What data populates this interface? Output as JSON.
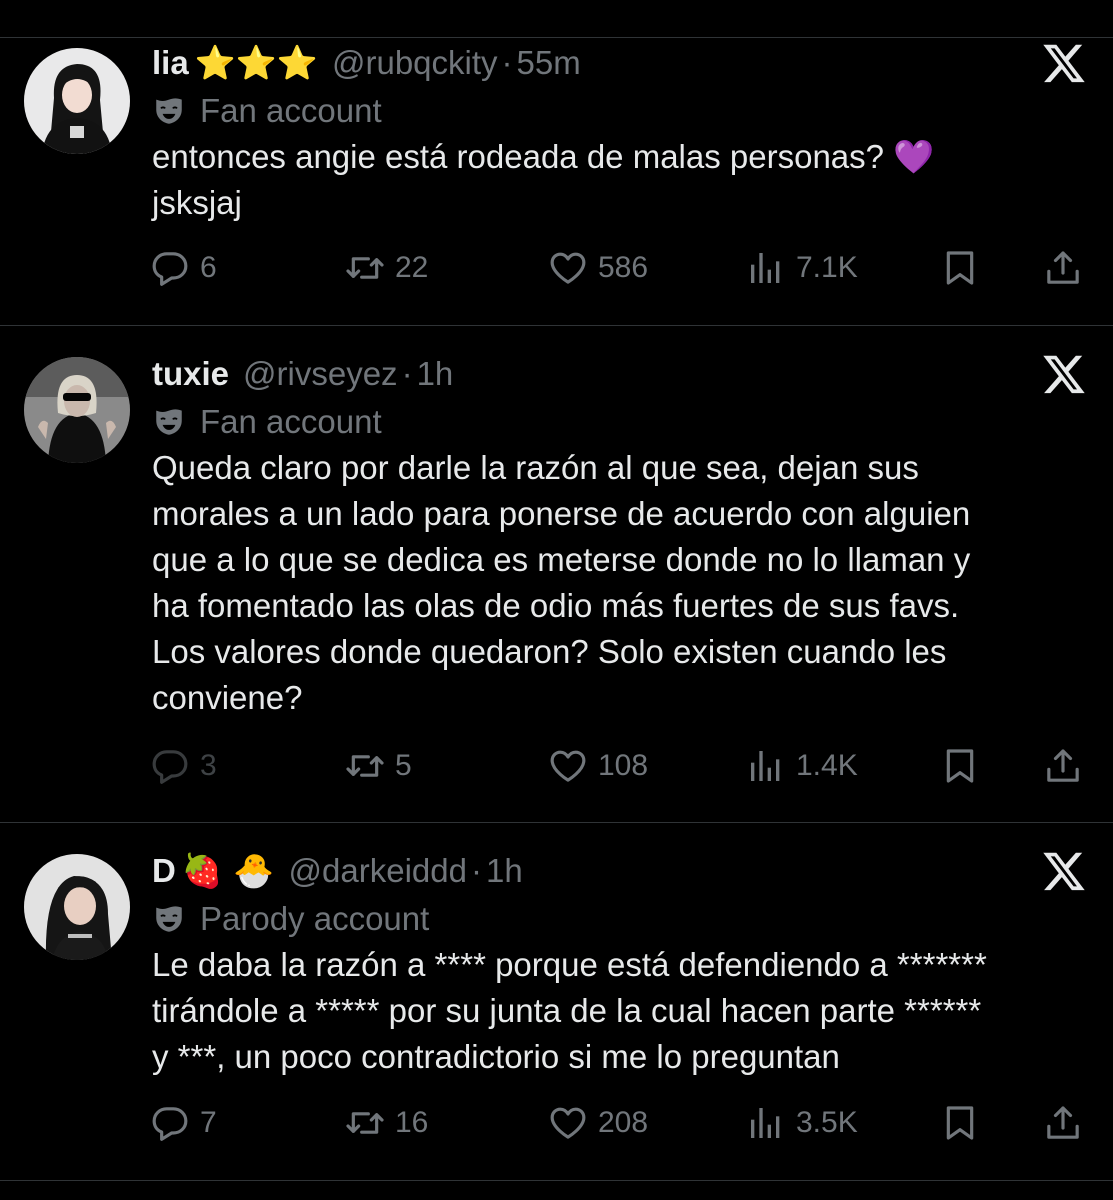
{
  "tweets": [
    {
      "name": "lia",
      "name_emoji": "⭐⭐⭐",
      "handle": "@rubqckity",
      "time": "55m",
      "account_label": "Fan account",
      "text_lines": [
        "entonces angie está rodeada de malas personas? 💜",
        "jsksjaj"
      ],
      "replies": "6",
      "reposts": "22",
      "likes": "586",
      "views": "7.1K"
    },
    {
      "name": "tuxie",
      "name_emoji": "",
      "handle": "@rivseyez",
      "time": "1h",
      "account_label": "Fan account",
      "text_lines": [
        "Queda claro por darle la razón al que sea, dejan sus",
        "morales a un lado para ponerse de acuerdo con alguien",
        "que a lo que se dedica es meterse donde no lo llaman y",
        "ha fomentado las olas de odio más fuertes de sus favs.",
        "Los valores donde quedaron? Solo existen cuando les",
        "conviene?"
      ],
      "replies": "3",
      "reposts": "5",
      "likes": "108",
      "views": "1.4K"
    },
    {
      "name": "D",
      "name_emoji": "🍓 🐣",
      "handle": "@darkeiddd",
      "time": "1h",
      "account_label": "Parody account",
      "text_lines": [
        "Le daba la razón a **** porque está defendiendo a *******",
        "tirándole a ***** por su junta de la cual hacen parte ******",
        "y ***, un poco contradictorio si me lo preguntan"
      ],
      "replies": "7",
      "reposts": "16",
      "likes": "208",
      "views": "3.5K"
    }
  ],
  "icons": {
    "close": "x-logo-icon",
    "badge": "mask-icon",
    "reply": "reply-icon",
    "repost": "repost-icon",
    "like": "heart-icon",
    "views": "views-icon",
    "bookmark": "bookmark-icon",
    "share": "share-icon"
  },
  "colors": {
    "background": "#000000",
    "text": "#e7e9ea",
    "muted": "#71767b",
    "divider": "#2f3336"
  }
}
